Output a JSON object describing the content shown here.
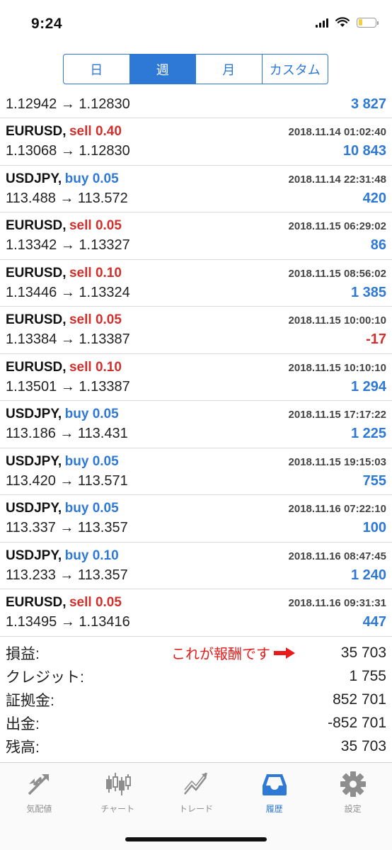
{
  "status_bar": {
    "time": "9:24"
  },
  "period_tabs": [
    {
      "label": "日",
      "active": false
    },
    {
      "label": "週",
      "active": true
    },
    {
      "label": "月",
      "active": false
    },
    {
      "label": "カスタム",
      "active": false
    }
  ],
  "partial_row": {
    "prices": "1.12942 → 1.12830",
    "profit": "3 827"
  },
  "trades": [
    {
      "symbol": "EURUSD,",
      "side": "sell 0.40",
      "type": "sell",
      "datetime": "2018.11.14 01:02:40",
      "prices": "1.13068 → 1.12830",
      "profit": "10 843",
      "negative": false
    },
    {
      "symbol": "USDJPY,",
      "side": "buy 0.05",
      "type": "buy",
      "datetime": "2018.11.14 22:31:48",
      "prices": "113.488 → 113.572",
      "profit": "420",
      "negative": false
    },
    {
      "symbol": "EURUSD,",
      "side": "sell 0.05",
      "type": "sell",
      "datetime": "2018.11.15 06:29:02",
      "prices": "1.13342 → 1.13327",
      "profit": "86",
      "negative": false
    },
    {
      "symbol": "EURUSD,",
      "side": "sell 0.10",
      "type": "sell",
      "datetime": "2018.11.15 08:56:02",
      "prices": "1.13446 → 1.13324",
      "profit": "1 385",
      "negative": false
    },
    {
      "symbol": "EURUSD,",
      "side": "sell 0.05",
      "type": "sell",
      "datetime": "2018.11.15 10:00:10",
      "prices": "1.13384 → 1.13387",
      "profit": "-17",
      "negative": true
    },
    {
      "symbol": "EURUSD,",
      "side": "sell 0.10",
      "type": "sell",
      "datetime": "2018.11.15 10:10:10",
      "prices": "1.13501 → 1.13387",
      "profit": "1 294",
      "negative": false
    },
    {
      "symbol": "USDJPY,",
      "side": "buy 0.05",
      "type": "buy",
      "datetime": "2018.11.15 17:17:22",
      "prices": "113.186 → 113.431",
      "profit": "1 225",
      "negative": false
    },
    {
      "symbol": "USDJPY,",
      "side": "buy 0.05",
      "type": "buy",
      "datetime": "2018.11.15 19:15:03",
      "prices": "113.420 → 113.571",
      "profit": "755",
      "negative": false
    },
    {
      "symbol": "USDJPY,",
      "side": "buy 0.05",
      "type": "buy",
      "datetime": "2018.11.16 07:22:10",
      "prices": "113.337 → 113.357",
      "profit": "100",
      "negative": false
    },
    {
      "symbol": "USDJPY,",
      "side": "buy 0.10",
      "type": "buy",
      "datetime": "2018.11.16 08:47:45",
      "prices": "113.233 → 113.357",
      "profit": "1 240",
      "negative": false
    },
    {
      "symbol": "EURUSD,",
      "side": "sell 0.05",
      "type": "sell",
      "datetime": "2018.11.16 09:31:31",
      "prices": "1.13495 → 1.13416",
      "profit": "447",
      "negative": false
    }
  ],
  "summary": [
    {
      "label": "損益:",
      "value": "35 703"
    },
    {
      "label": "クレジット:",
      "value": "1 755"
    },
    {
      "label": "証拠金:",
      "value": "852 701"
    },
    {
      "label": "出金:",
      "value": "-852 701"
    },
    {
      "label": "残高:",
      "value": "35 703"
    }
  ],
  "annotation": {
    "text": "これが報酬です",
    "color": "#e81a1a"
  },
  "tabbar": [
    {
      "label": "気配値",
      "icon": "quotes-arrow-icon",
      "active": false
    },
    {
      "label": "チャート",
      "icon": "candlestick-chart-icon",
      "active": false
    },
    {
      "label": "トレード",
      "icon": "trade-chart-icon",
      "active": false
    },
    {
      "label": "履歴",
      "icon": "history-inbox-icon",
      "active": true
    },
    {
      "label": "設定",
      "icon": "gear-icon",
      "active": false
    }
  ],
  "colors": {
    "accent": "#2f79d6",
    "sell": "#d0312d",
    "buy": "#2f79d6"
  }
}
